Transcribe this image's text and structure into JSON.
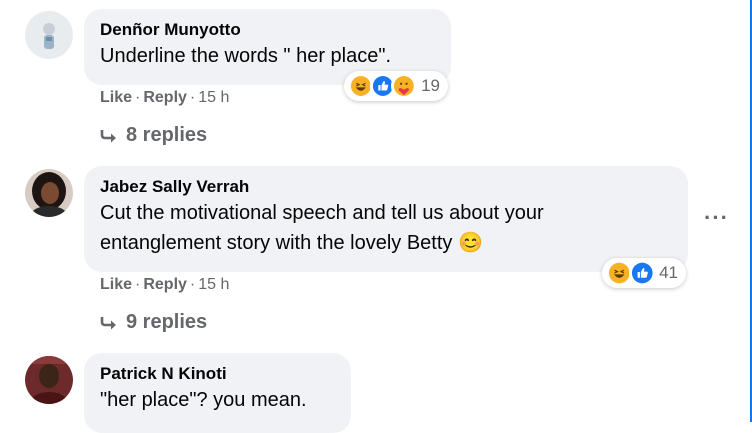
{
  "comments": [
    {
      "author": "Denñor Munyotto",
      "text_lines": [
        "Underline the words \" her place\"."
      ],
      "like": "Like",
      "reply": "Reply",
      "time": "15 h",
      "reaction_count": "19",
      "reactions": [
        "haha-icon",
        "like-icon",
        "care-icon"
      ],
      "replies": "8 replies"
    },
    {
      "author": "Jabez Sally Verrah",
      "text_lines": [
        "Cut the motivational speech and tell us about your",
        "entanglement story with the lovely Betty"
      ],
      "emoji": "😊",
      "like": "Like",
      "reply": "Reply",
      "time": "15 h",
      "reaction_count": "41",
      "reactions": [
        "haha-icon",
        "like-icon"
      ],
      "replies": "9 replies",
      "more": "···"
    },
    {
      "author": "Patrick N Kinoti",
      "text_lines": [
        "\"her place\"? you mean."
      ]
    }
  ],
  "separator": "·",
  "colors": {
    "bubble": "#f0f2f5",
    "meta": "#65676b",
    "like_blue": "#1877f2",
    "haha_yellow": "#f7b125",
    "edge_blue": "#1a73e8"
  }
}
